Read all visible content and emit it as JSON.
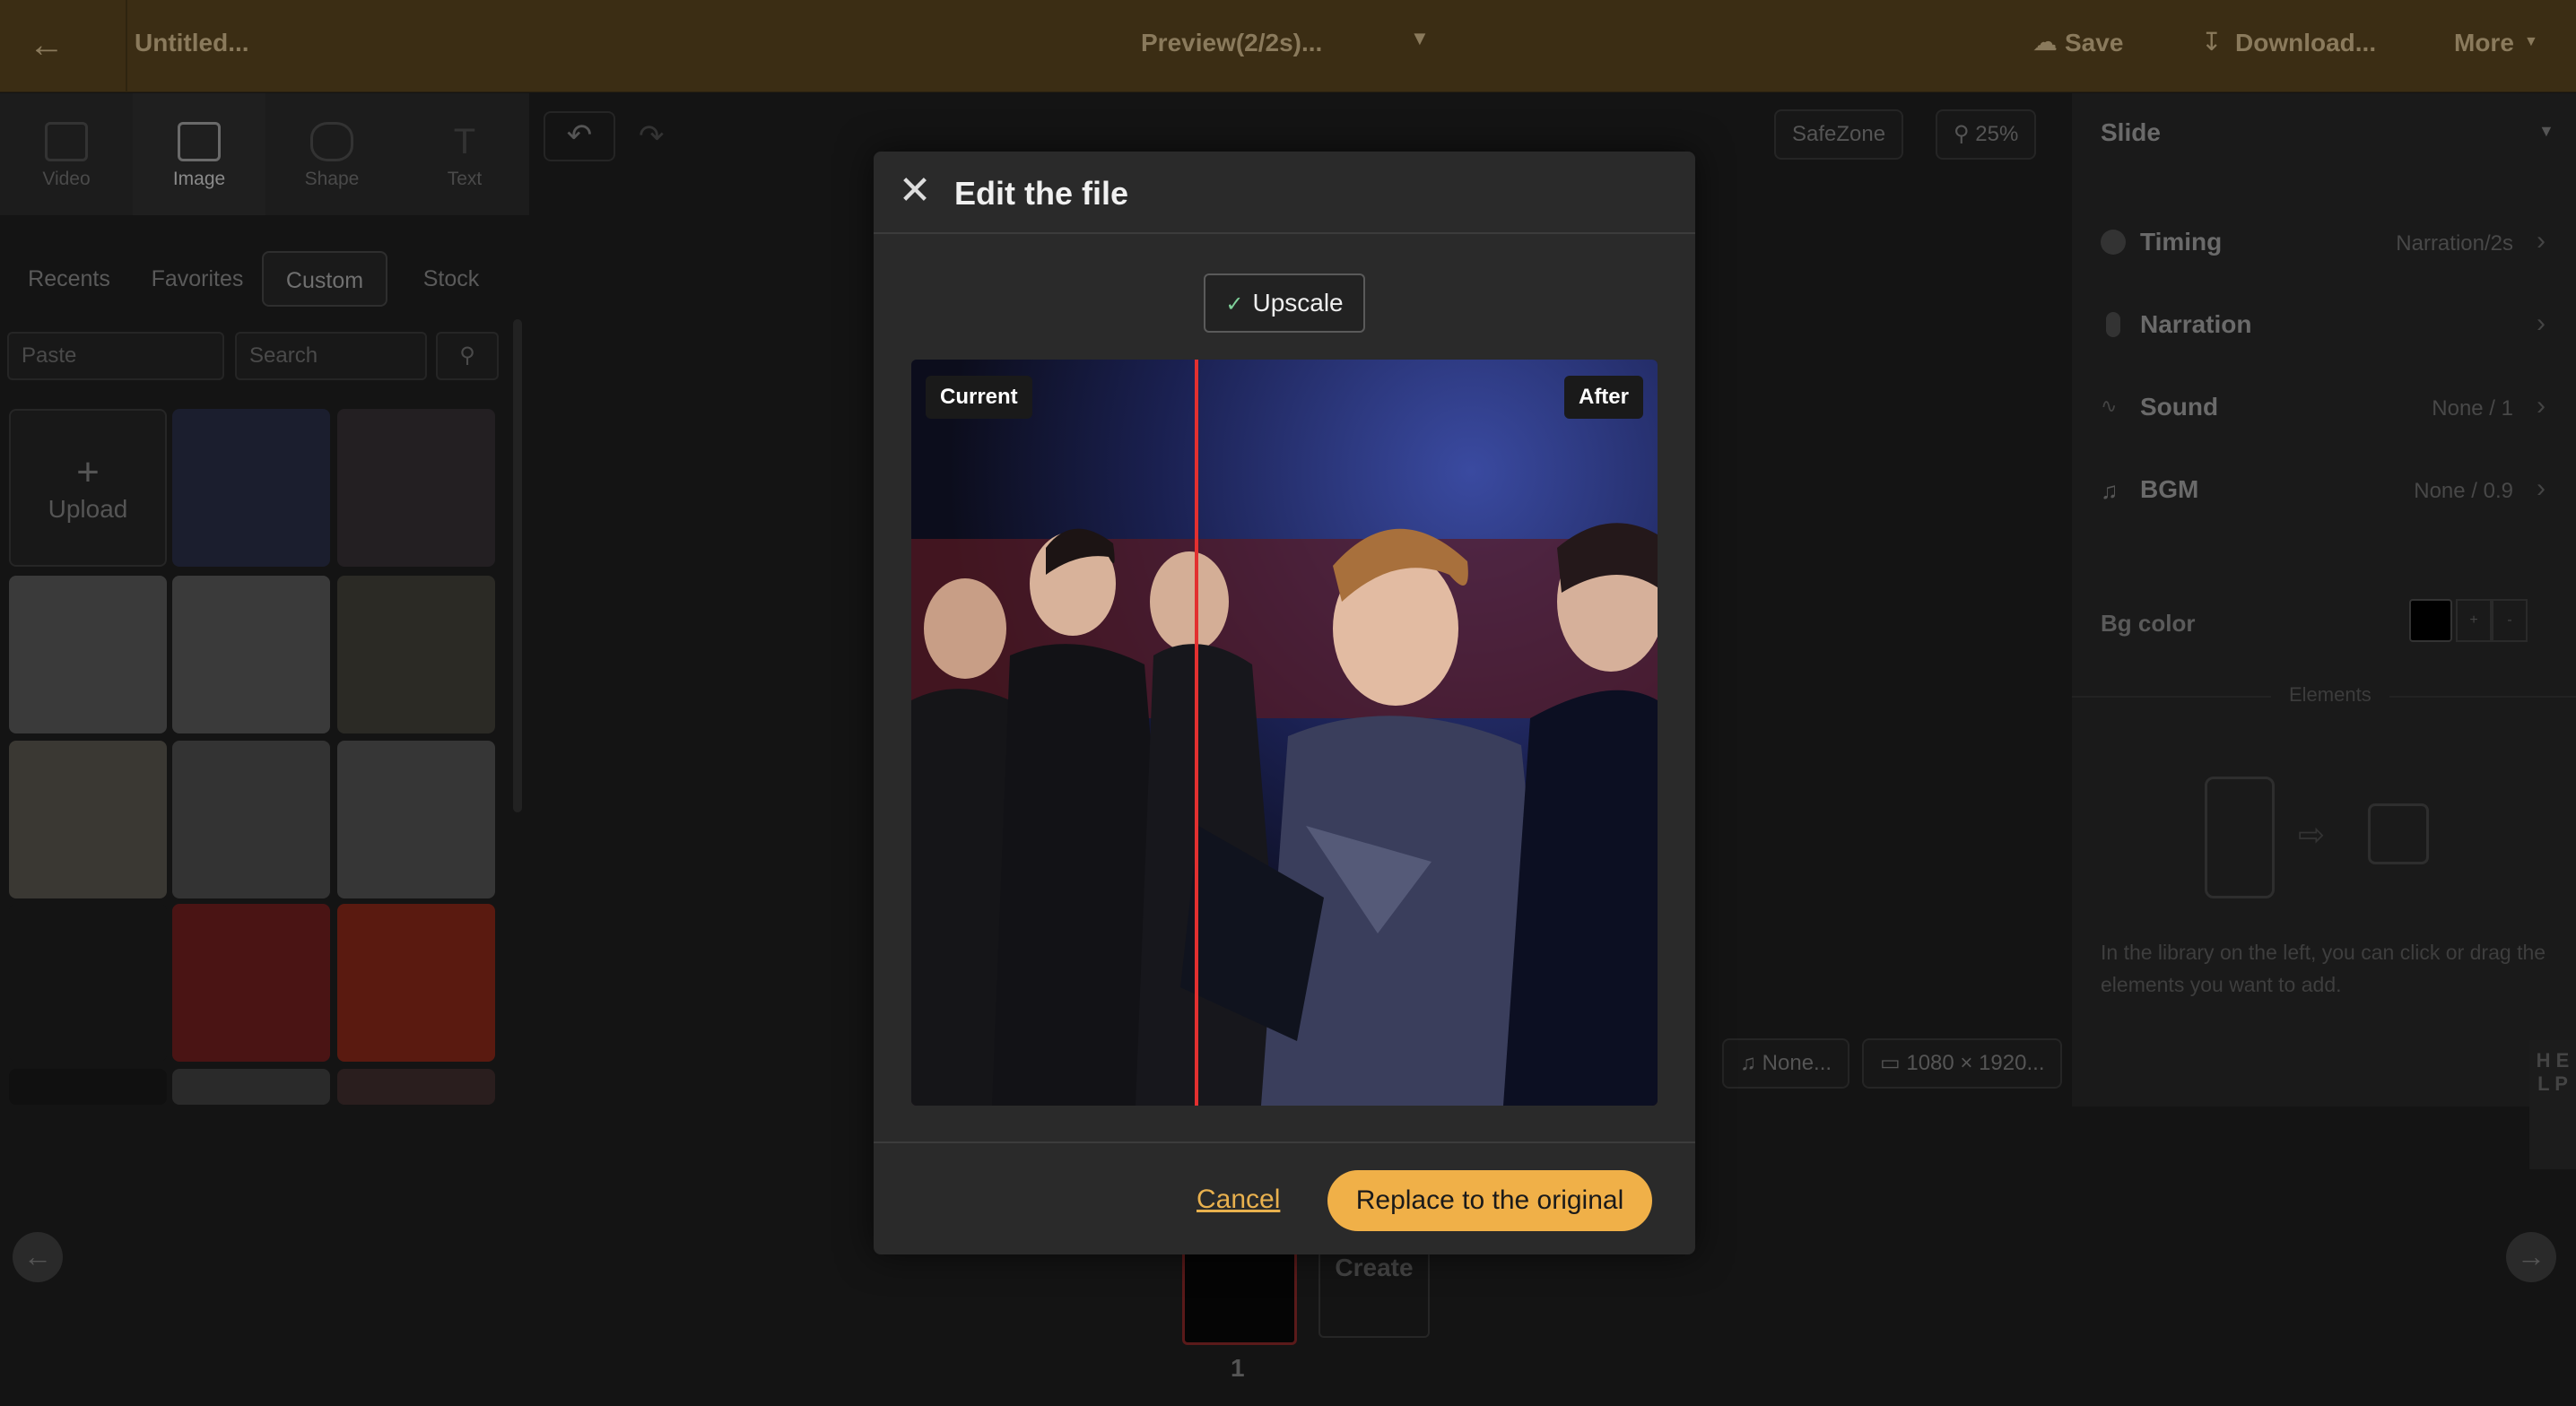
{
  "topbar": {
    "title": "Untitled...",
    "preview": "Preview(2/2s)...",
    "save": "Save",
    "download": "Download...",
    "more": "More",
    "icons": [
      "back-arrow-icon",
      "cloud-upload-icon",
      "download-icon",
      "caret-down-icon"
    ]
  },
  "lefttools": [
    {
      "label": "Video",
      "icon": "video-icon"
    },
    {
      "label": "Image",
      "icon": "image-icon"
    },
    {
      "label": "Shape",
      "icon": "pentagon-icon"
    },
    {
      "label": "Text",
      "icon": "text-icon"
    }
  ],
  "tabs": [
    "Recents",
    "Favorites",
    "Custom",
    "Stock"
  ],
  "search": {
    "source": "Paste",
    "placeholder": "Search"
  },
  "library": {
    "upload": "Upload"
  },
  "canvas": {
    "safezone": "SafeZone",
    "zoom": "25%",
    "audio": "None...",
    "size": "1080 × 1920..."
  },
  "right": {
    "title": "Slide",
    "rows": [
      {
        "label": "Timing",
        "value": "Narration/2s"
      },
      {
        "label": "Narration",
        "value": ""
      },
      {
        "label": "Sound",
        "value": "None / 1"
      },
      {
        "label": "BGM",
        "value": "None / 0.9"
      }
    ],
    "bgcolor": "Bg color",
    "elements": "Elements",
    "hint": "In the library on the left, you can click or drag the elements you want to add."
  },
  "modal": {
    "title": "Edit the file",
    "upscale": "Upscale",
    "current": "Current",
    "after": "After",
    "cancel": "Cancel",
    "replace": "Replace to the original"
  },
  "bottom": {
    "create": "Create",
    "slide_num": "1",
    "help": "H E L P"
  },
  "colors": {
    "accent": "#f0b048",
    "divider": "#e23030",
    "topbar": "#3b2d14"
  }
}
